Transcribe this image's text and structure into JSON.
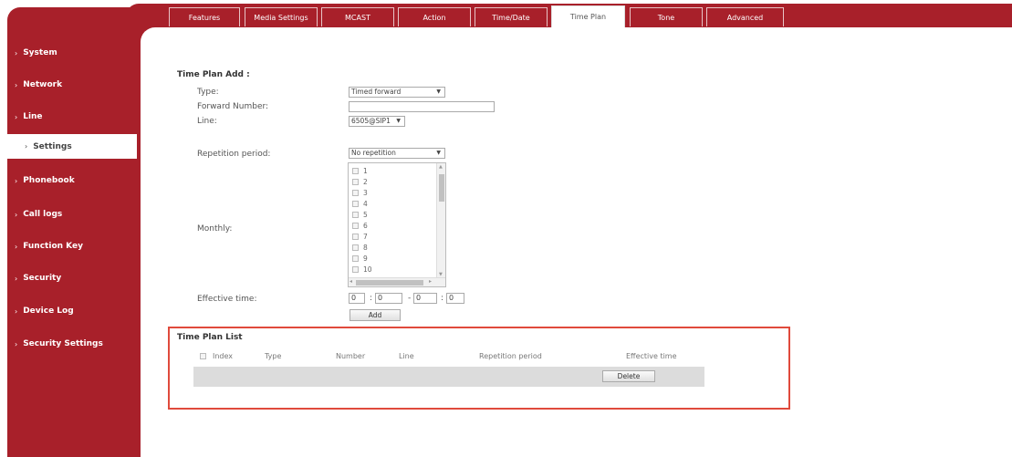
{
  "colors": {
    "brand": "#a8202a",
    "highlight": "#e04a3c"
  },
  "tabs": [
    {
      "label": "Features"
    },
    {
      "label": "Media Settings"
    },
    {
      "label": "MCAST"
    },
    {
      "label": "Action"
    },
    {
      "label": "Time/Date"
    },
    {
      "label": "Time Plan"
    },
    {
      "label": "Tone"
    },
    {
      "label": "Advanced"
    }
  ],
  "sidebar": {
    "items": [
      {
        "label": "System"
      },
      {
        "label": "Network"
      },
      {
        "label": "Line"
      },
      {
        "label": "Settings"
      },
      {
        "label": "Phonebook"
      },
      {
        "label": "Call logs"
      },
      {
        "label": "Function Key"
      },
      {
        "label": "Security"
      },
      {
        "label": "Device Log"
      },
      {
        "label": "Security Settings"
      }
    ],
    "active": "Settings"
  },
  "form": {
    "title": "Time Plan Add :",
    "type_label": "Type:",
    "type_value": "Timed forward",
    "forward_label": "Forward Number:",
    "forward_value": "",
    "line_label": "Line:",
    "line_value": "6505@SIP1",
    "repetition_label": "Repetition period:",
    "repetition_value": "No repetition",
    "monthly_label": "Monthly:",
    "monthly_days": [
      "1",
      "2",
      "3",
      "4",
      "5",
      "6",
      "7",
      "8",
      "9",
      "10"
    ],
    "effective_label": "Effective time:",
    "time_start_h": "0",
    "time_start_m": "0",
    "time_end_h": "0",
    "time_end_m": "0",
    "colon": ":",
    "dash": "-",
    "add_button": "Add",
    "arrow_down": "▼",
    "arrow_up": "▲",
    "arrow_left": "◂",
    "arrow_right": "▸"
  },
  "list": {
    "title": "Time Plan List",
    "columns": [
      "Index",
      "Type",
      "Number",
      "Line",
      "Repetition period",
      "Effective time"
    ],
    "delete_button": "Delete"
  }
}
